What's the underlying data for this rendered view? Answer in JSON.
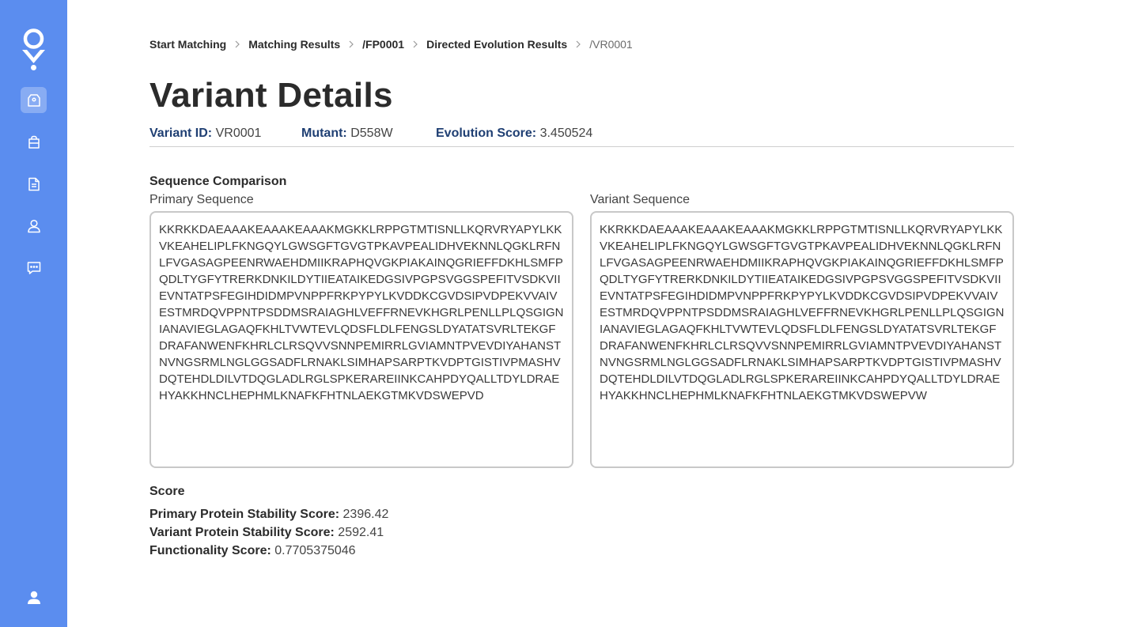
{
  "breadcrumb": {
    "items": [
      "Start Matching",
      "Matching Results",
      "/FP0001",
      "Directed Evolution Results"
    ],
    "current": "/VR0001"
  },
  "page": {
    "title": "Variant Details"
  },
  "meta": {
    "variant_id_label": "Variant ID:",
    "variant_id": "VR0001",
    "mutant_label": "Mutant:",
    "mutant": "D558W",
    "evolution_score_label": "Evolution Score:",
    "evolution_score": "3.450524"
  },
  "sequence": {
    "title": "Sequence Comparison",
    "primary_label": "Primary Sequence",
    "variant_label": "Variant Sequence",
    "primary": "KKRKKDAEAAAKEAAAKEAAAKMGKKLRPPGTMTISNLLKQRVRYAPYLKKVKEAHELIPLFKNGQYLGWSGFTGVGTPKAVPEALIDHVEKNNLQGKLRFNLFVGASAGPEENRWAEHDMIIKRAPHQVGKPIAKAINQGRIEFFDKHLSMFPQDLTYGFYTRERKDNKILDYTIIEATAIKEDGSIVPGPSVGGSPEFITVSDKVIIEVNTATPSFEGIHDIDMPVNPPFRKPYPYLKVDDKCGVDSIPVDPEKVVAIVESTMRDQVPPNTPSDDMSRAIAGHLVEFFRNEVKHGRLPENLLPLQSGIGNIANAVIEGLAGAQFKHLTVWTEVLQDSFLDLFENGSLDYATATSVRLTEKGFDRAFANWENFKHRLCLRSQVVSNNPEMIRRLGVIAMNTPVEVDIYAHANSTNVNGSRMLNGLGGSADFLRNAKLSIMHAPSARPTKVDPTGISTIVPMASHVDQTEHDLDILVTDQGLADLRGLSPKERAREIINKCAHPDYQALLTDYLDRAEHYAKKHNCLHEPHMLKNAFKFHTNLAEKGTMKVDSWEPVD",
    "variant": "KKRKKDAEAAAKEAAAKEAAAKMGKKLRPPGTMTISNLLKQRVRYAPYLKKVKEAHELIPLFKNGQYLGWSGFTGVGTPKAVPEALIDHVEKNNLQGKLRFNLFVGASAGPEENRWAEHDMIIKRAPHQVGKPIAKAINQGRIEFFDKHLSMFPQDLTYGFYTRERKDNKILDYTIIEATAIKEDGSIVPGPSVGGSPEFITVSDKVIIEVNTATPSFEGIHDIDMPVNPPFRKPYPYLKVDDKCGVDSIPVDPEKVVAIVESTMRDQVPPNTPSDDMSRAIAGHLVEFFRNEVKHGRLPENLLPLQSGIGNIANAVIEGLAGAQFKHLTVWTEVLQDSFLDLFENGSLDYATATSVRLTEKGFDRAFANWENFKHRLCLRSQVVSNNPEMIRRLGVIAMNTPVEVDIYAHANSTNVNGSRMLNGLGGSADFLRNAKLSIMHAPSARPTKVDPTGISTIVPMASHVDQTEHDLDILVTDQGLADLRGLSPKERAREIINKCAHPDYQALLTDYLDRAEHYAKKHNCLHEPHMLKNAFKFHTNLAEKGTMKVDSWEPVW"
  },
  "score": {
    "title": "Score",
    "primary_stability_label": "Primary Protein Stability Score:",
    "primary_stability": "2396.42",
    "variant_stability_label": "Variant Protein Stability Score:",
    "variant_stability": "2592.41",
    "functionality_label": "Functionality Score:",
    "functionality": "0.7705375046"
  },
  "sidebar": {
    "accent": "#5b8def",
    "icons": [
      "app-logo-icon",
      "tag-icon",
      "shopping-bag-icon",
      "document-icon",
      "user-icon",
      "chat-icon",
      "profile-icon"
    ]
  }
}
